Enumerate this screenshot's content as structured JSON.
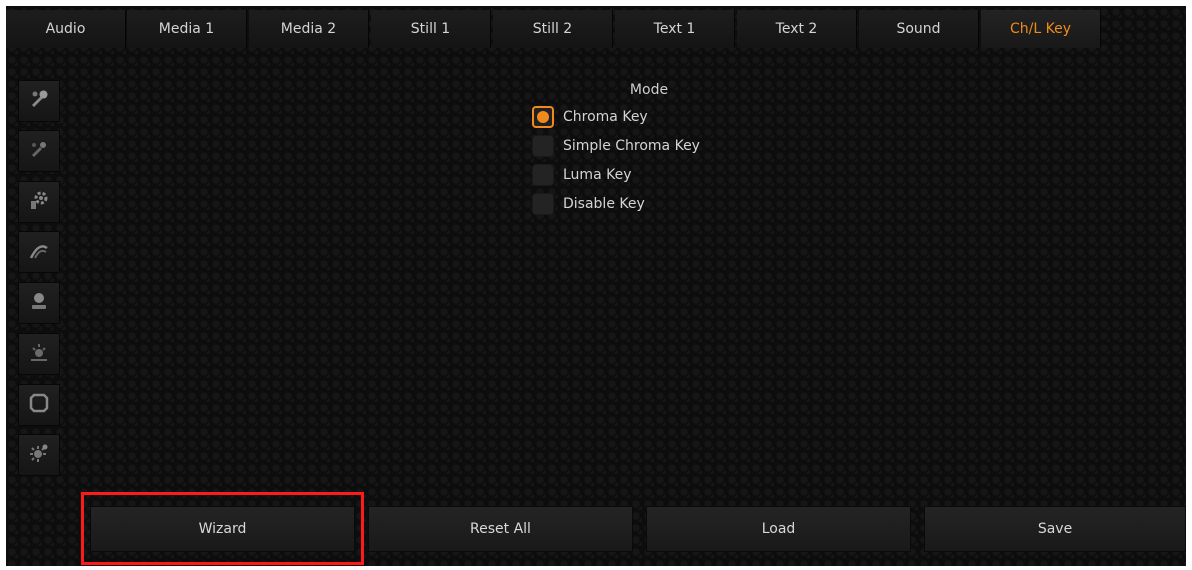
{
  "tabs": [
    {
      "label": "Audio",
      "active": false
    },
    {
      "label": "Media 1",
      "active": false
    },
    {
      "label": "Media 2",
      "active": false
    },
    {
      "label": "Still 1",
      "active": false
    },
    {
      "label": "Still 2",
      "active": false
    },
    {
      "label": "Text 1",
      "active": false
    },
    {
      "label": "Text 2",
      "active": false
    },
    {
      "label": "Sound",
      "active": false
    },
    {
      "label": "Ch/L Key",
      "active": true
    }
  ],
  "sidebar": {
    "icons": [
      "pick-color-icon",
      "pick-color-alt-icon",
      "settings-gear-icon",
      "edge-spill-icon",
      "mask-icon",
      "light-icon",
      "crop-frame-icon",
      "sparkle-icon"
    ]
  },
  "mode": {
    "title": "Mode",
    "options": [
      {
        "label": "Chroma Key",
        "selected": true
      },
      {
        "label": "Simple Chroma Key",
        "selected": false
      },
      {
        "label": "Luma Key",
        "selected": false
      },
      {
        "label": "Disable Key",
        "selected": false
      }
    ]
  },
  "buttons": {
    "wizard": "Wizard",
    "reset_all": "Reset All",
    "load": "Load",
    "save": "Save"
  },
  "colors": {
    "accent": "#f08a1c",
    "highlight": "#ff1a1a"
  }
}
